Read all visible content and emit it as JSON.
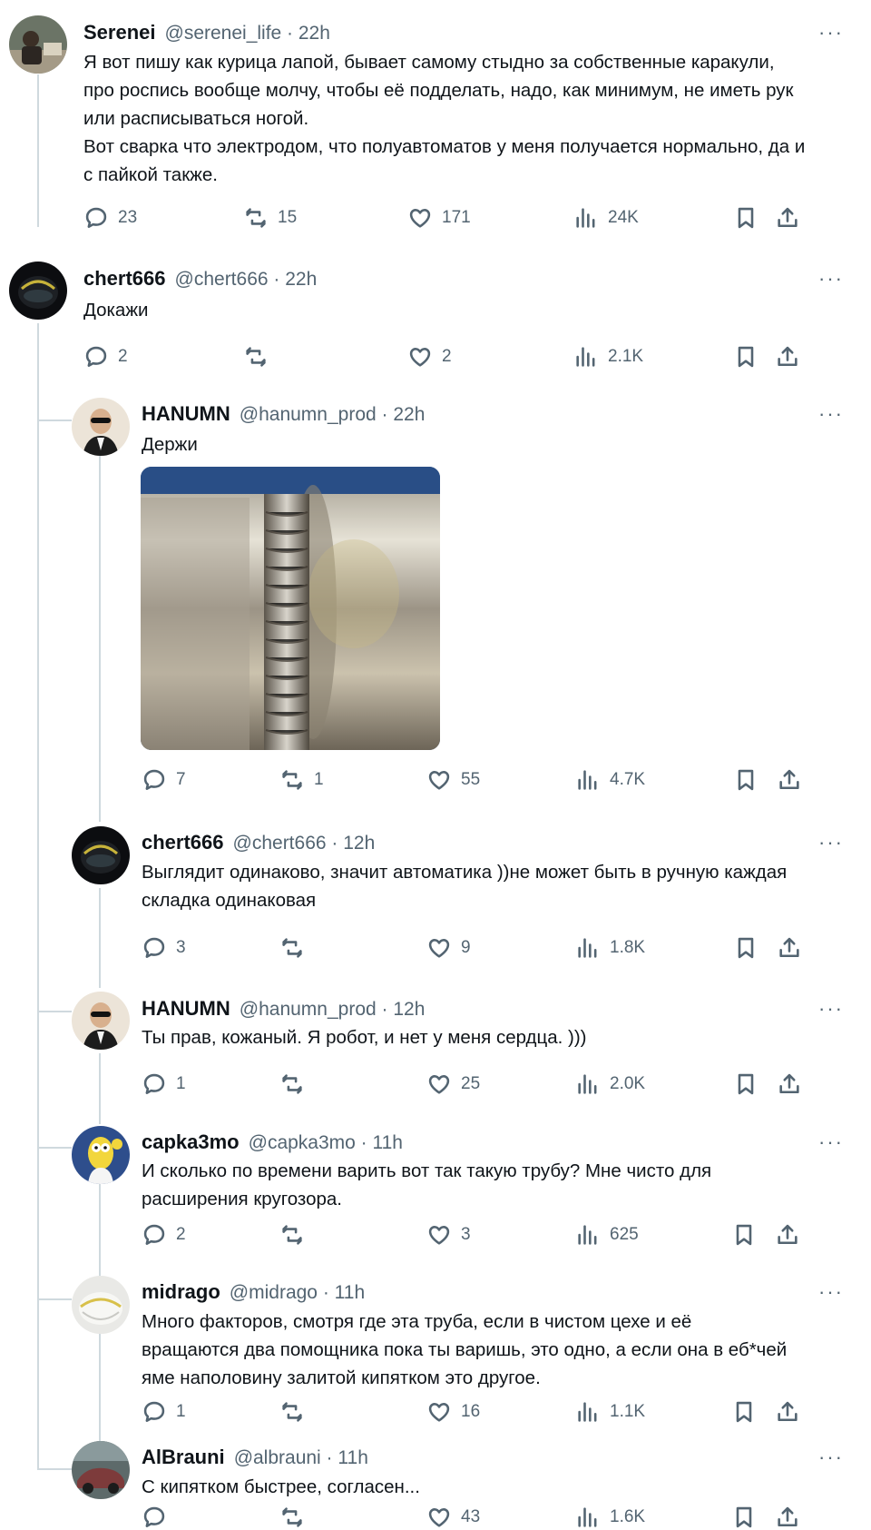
{
  "tweets": [
    {
      "name": "Serenei",
      "handle": "@serenei_life · 22h",
      "text": "Я вот пишу как курица лапой, бывает самому стыдно за собственные каракули,\nпро роспись вообще молчу, чтобы её подделать, надо, как минимум, не иметь рук\nили расписываться ногой.\nВот сварка что электродом, что полуавтоматов у меня получается нормально, да и\nс пайкой также.",
      "replies": "23",
      "retweets": "15",
      "likes": "171",
      "views": "24K"
    },
    {
      "name": "chert666",
      "handle": "@chert666 · 22h",
      "text": "Докажи",
      "replies": "2",
      "retweets": "",
      "likes": "2",
      "views": "2.1K"
    },
    {
      "name": "HANUMN",
      "handle": "@hanumn_prod · 22h",
      "text": "Держи",
      "replies": "7",
      "retweets": "1",
      "likes": "55",
      "views": "4.7K"
    },
    {
      "name": "chert666",
      "handle": "@chert666 · 12h",
      "text": "Выглядит одинаково, значит автоматика ))не может быть в ручную каждая\nскладка одинаковая",
      "replies": "3",
      "retweets": "",
      "likes": "9",
      "views": "1.8K"
    },
    {
      "name": "HANUMN",
      "handle": "@hanumn_prod · 12h",
      "text": "Ты прав, кожаный. Я робот, и нет у меня сердца. )))",
      "replies": "1",
      "retweets": "",
      "likes": "25",
      "views": "2.0K"
    },
    {
      "name": "capka3mo",
      "handle": "@capka3mo · 11h",
      "text": "И сколько по времени варить вот так такую трубу? Мне чисто для\nрасширения кругозора.",
      "replies": "2",
      "retweets": "",
      "likes": "3",
      "views": "625"
    },
    {
      "name": "midrago",
      "handle": "@midrago · 11h",
      "text": "Много факторов, смотря где эта труба, если в чистом цехе и её\nвращаются два помощника пока ты варишь, это одно, а если она в еб*чей\nяме наполовину залитой кипятком это другое.",
      "replies": "1",
      "retweets": "",
      "likes": "16",
      "views": "1.1K"
    },
    {
      "name": "AlBrauni",
      "handle": "@albrauni · 11h",
      "text": "С кипятком быстрее, согласен...",
      "replies": "",
      "retweets": "",
      "likes": "43",
      "views": "1.6K"
    }
  ],
  "more_label": "···",
  "colors": {
    "text": "#0f1419",
    "secondary": "#536471",
    "thread_line": "#cfd9de"
  }
}
